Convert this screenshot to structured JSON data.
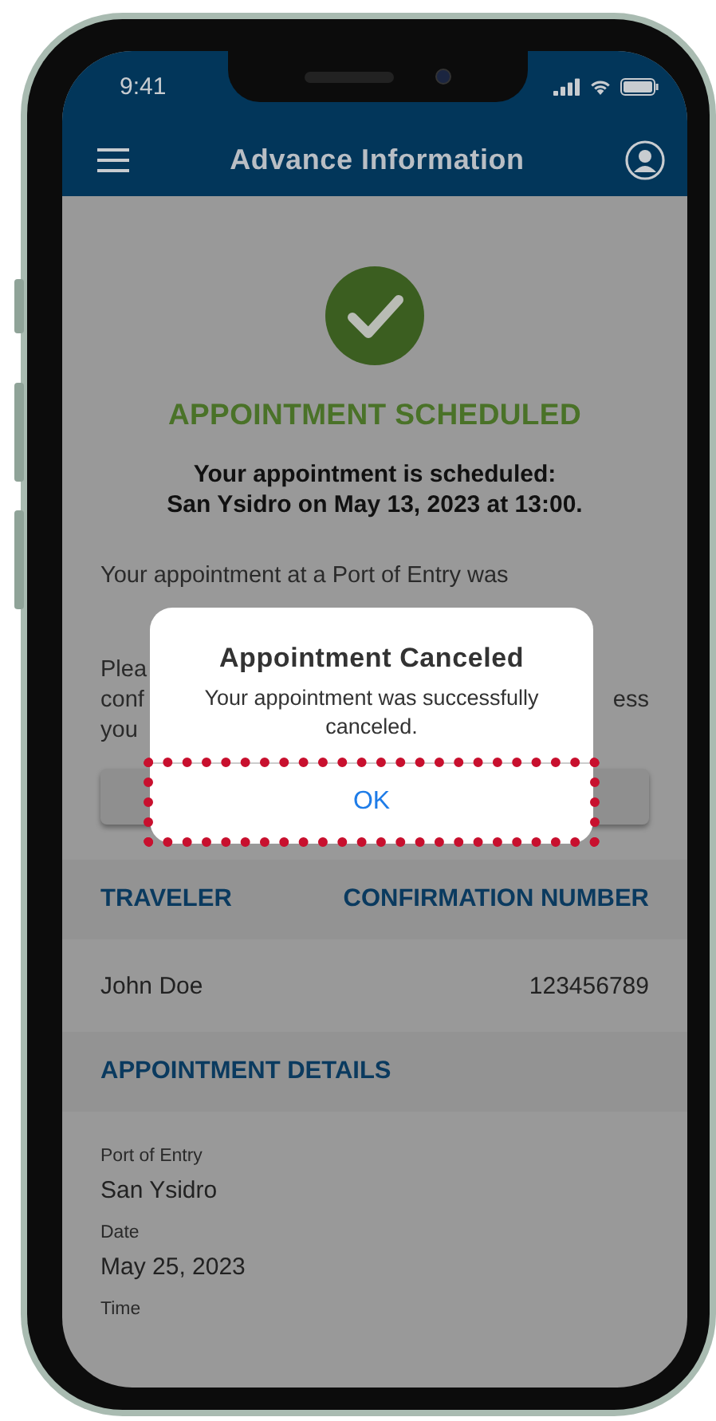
{
  "status_bar": {
    "time": "9:41"
  },
  "header": {
    "title": "Advance Information"
  },
  "confirmation": {
    "heading": "APPOINTMENT SCHEDULED",
    "summary_lines": [
      "Your appointment is scheduled:",
      "San Ysidro on May 13, 2023 at 13:00."
    ],
    "paragraph_1": "Your appointment at a Port of Entry was",
    "paragraph_2_fragments": [
      {
        "left": "Plea"
      },
      {
        "left": "conf",
        "right": "ess"
      },
      {
        "left": "you"
      }
    ]
  },
  "traveler_table": {
    "columns": [
      "TRAVELER",
      "CONFIRMATION NUMBER"
    ],
    "rows": [
      [
        "John Doe",
        "123456789"
      ]
    ]
  },
  "appointment_details": {
    "title": "APPOINTMENT DETAILS",
    "fields": [
      {
        "label": "Port of Entry",
        "value": "San Ysidro"
      },
      {
        "label": "Date",
        "value": "May 25, 2023"
      },
      {
        "label": "Time"
      }
    ]
  },
  "dialog": {
    "title": "Appointment Canceled",
    "message": "Your appointment was successfully canceled.",
    "button": "OK",
    "highlighted": true
  }
}
